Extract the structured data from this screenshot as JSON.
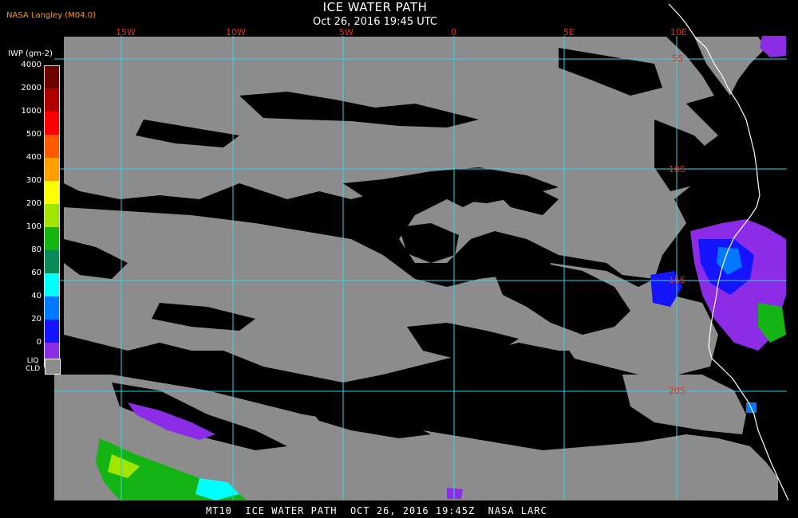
{
  "header": {
    "producer": "NASA Langley (M04.0)",
    "title": "ICE WATER PATH",
    "subtitle": "Oct 26, 2016 19:45 UTC"
  },
  "footer": {
    "text": "MT10  ICE WATER PATH  OCT 26, 2016 19:45Z  NASA LARC"
  },
  "legend": {
    "unit": "IWP (gm-2)",
    "levels": [
      {
        "label": "4000",
        "color": "#6e0000"
      },
      {
        "label": "2000",
        "color": "#b00000"
      },
      {
        "label": "1000",
        "color": "#ff0000"
      },
      {
        "label": "500",
        "color": "#ff5a00"
      },
      {
        "label": "400",
        "color": "#ffa000"
      },
      {
        "label": "300",
        "color": "#ffff00"
      },
      {
        "label": "200",
        "color": "#a0e600"
      },
      {
        "label": "100",
        "color": "#14b414"
      },
      {
        "label": "80",
        "color": "#0a8c5a"
      },
      {
        "label": "60",
        "color": "#00ffff"
      },
      {
        "label": "40",
        "color": "#0078ff"
      },
      {
        "label": "20",
        "color": "#1414ff"
      },
      {
        "label": "0",
        "color": "#8c2ce6"
      }
    ],
    "liq_cld": {
      "label_line1": "LIQ",
      "label_line2": "CLD",
      "color": "#8c8c8c"
    }
  },
  "map": {
    "longitude_labels": [
      "15W",
      "10W",
      "5W",
      "0",
      "5E",
      "10E"
    ],
    "latitude_labels": [
      "5S",
      "10S",
      "15S",
      "20S"
    ],
    "colors": {
      "background": "#000000",
      "cloud": "#8c8c8c",
      "grid": "#34d3e8",
      "grid_label": "#e0301e",
      "coastline": "#ffffff"
    }
  }
}
